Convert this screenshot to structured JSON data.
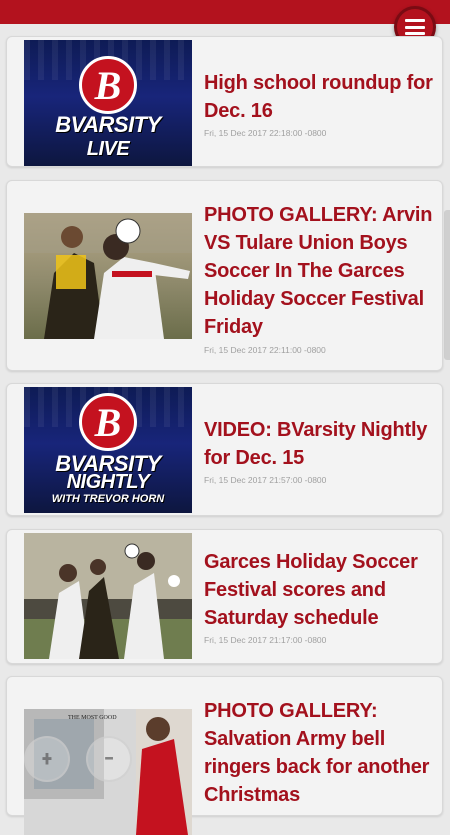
{
  "colors": {
    "brand_red": "#b3121e",
    "title_red": "#a3111d",
    "date_gray": "#a0a0a0"
  },
  "header": {
    "menu_icon": "hamburger-menu-icon"
  },
  "articles": [
    {
      "title": "High school roundup for Dec. 16",
      "date": "Fri, 15 Dec 2017 22:18:00 -0800",
      "thumb_logo": "B",
      "thumb_line1": "BVARSITY",
      "thumb_line2": "LIVE"
    },
    {
      "title": "PHOTO GALLERY: Arvin VS Tulare Union Boys Soccer In The Garces Holiday Soccer Festival Friday",
      "date": "Fri, 15 Dec 2017 22:11:00 -0800"
    },
    {
      "title": "VIDEO: BVarsity Nightly for Dec. 15",
      "date": "Fri, 15 Dec 2017 21:57:00 -0800",
      "thumb_logo": "B",
      "thumb_line1": "BVARSITY",
      "thumb_line2": "NIGHTLY",
      "thumb_line3": "WITH TREVOR HORN"
    },
    {
      "title": "Garces Holiday Soccer Festival scores and Saturday schedule",
      "date": "Fri, 15 Dec 2017 21:17:00 -0800"
    },
    {
      "title": "PHOTO GALLERY: Salvation Army bell ringers back for another Christmas",
      "thumb_sign": "THE MOST GOOD"
    }
  ],
  "zoom": {
    "zoom_in": "+",
    "zoom_out": "−"
  }
}
